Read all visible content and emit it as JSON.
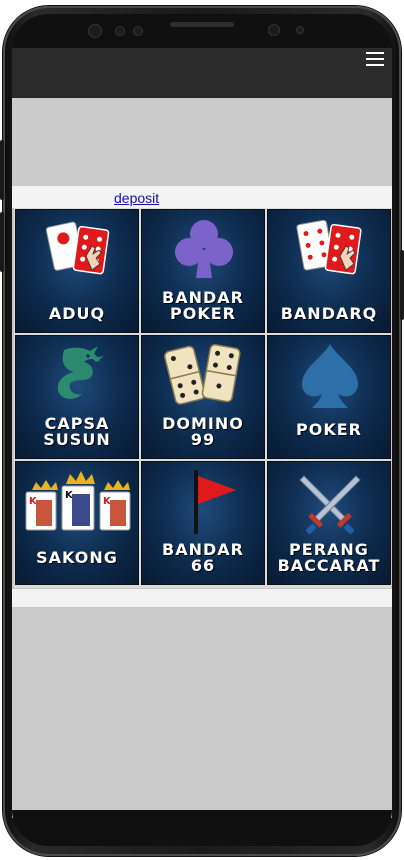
{
  "header": {
    "menu_icon": "hamburger-menu-icon"
  },
  "links": {
    "deposit": "deposit"
  },
  "games": [
    {
      "id": "aduq",
      "line1": "ADUQ",
      "line2": "",
      "icon": "domino-cards-icon"
    },
    {
      "id": "bandar-poker",
      "line1": "BANDAR",
      "line2": "POKER",
      "icon": "club-suit-icon"
    },
    {
      "id": "bandarq",
      "line1": "BANDARQ",
      "line2": "",
      "icon": "domino-cards-icon"
    },
    {
      "id": "capsa-susun",
      "line1": "CAPSA",
      "line2": "SUSUN",
      "icon": "dragon-icon"
    },
    {
      "id": "domino-99",
      "line1": "DOMINO",
      "line2": "99",
      "icon": "dice-dominoes-icon"
    },
    {
      "id": "poker",
      "line1": "POKER",
      "line2": "",
      "icon": "spade-suit-icon"
    },
    {
      "id": "sakong",
      "line1": "SAKONG",
      "line2": "",
      "icon": "king-cards-icon"
    },
    {
      "id": "bandar-66",
      "line1": "BANDAR",
      "line2": "66",
      "icon": "red-flag-icon"
    },
    {
      "id": "perang-baccarat",
      "line1": "PERANG",
      "line2": "BACCARAT",
      "icon": "crossed-swords-icon"
    }
  ],
  "colors": {
    "tile_bg": "#0c2a4c",
    "topbar": "#2b2b2b",
    "link": "#1a0dab",
    "accent_red": "#e01a1a",
    "club_purple": "#7b63c9",
    "spade_blue": "#2d6fa8",
    "dragon_teal": "#2c8a6e"
  }
}
